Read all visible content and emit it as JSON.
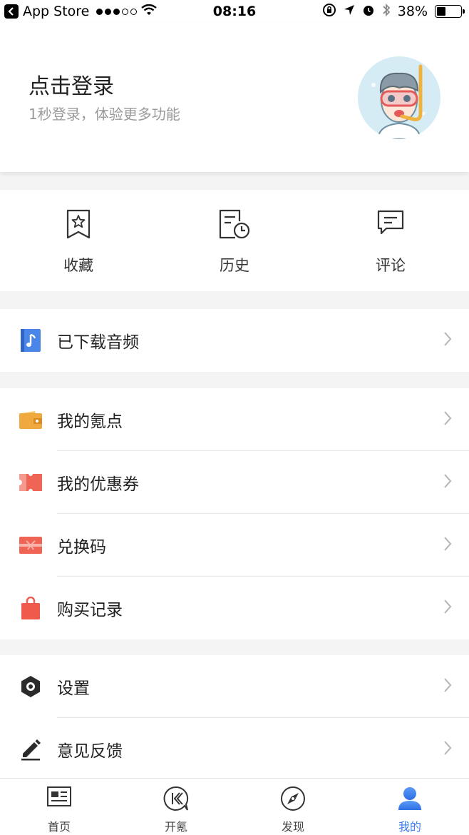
{
  "status_bar": {
    "back_app": "App Store",
    "time": "08:16",
    "battery": "38%",
    "battery_level": 0.38
  },
  "profile": {
    "title": "点击登录",
    "subtitle": "1秒登录，体验更多功能"
  },
  "quick_actions": [
    {
      "label": "收藏",
      "icon": "bookmark-star-icon"
    },
    {
      "label": "历史",
      "icon": "history-clock-icon"
    },
    {
      "label": "评论",
      "icon": "comment-icon"
    }
  ],
  "menu": {
    "downloads": {
      "label": "已下载音频",
      "icon": "music-note-icon",
      "color": "#4a86e8"
    },
    "account": [
      {
        "label": "我的氪点",
        "icon": "wallet-icon",
        "color": "#f0a93e"
      },
      {
        "label": "我的优惠券",
        "icon": "coupon-icon",
        "color": "#ef6454"
      },
      {
        "label": "兑换码",
        "icon": "gift-card-icon",
        "color": "#ef6454"
      },
      {
        "label": "购买记录",
        "icon": "shopping-bag-icon",
        "color": "#ef5a4c"
      }
    ],
    "settings": [
      {
        "label": "设置",
        "icon": "settings-hex-icon",
        "color": "#2b2b2b"
      },
      {
        "label": "意见反馈",
        "icon": "pencil-icon",
        "color": "#2b2b2b"
      }
    ]
  },
  "tab_bar": {
    "tabs": [
      {
        "label": "首页",
        "icon": "news-icon"
      },
      {
        "label": "开氪",
        "icon": "kr-icon"
      },
      {
        "label": "发现",
        "icon": "compass-icon"
      },
      {
        "label": "我的",
        "icon": "user-icon",
        "active": true
      }
    ],
    "active_color": "#3b7cf0"
  }
}
